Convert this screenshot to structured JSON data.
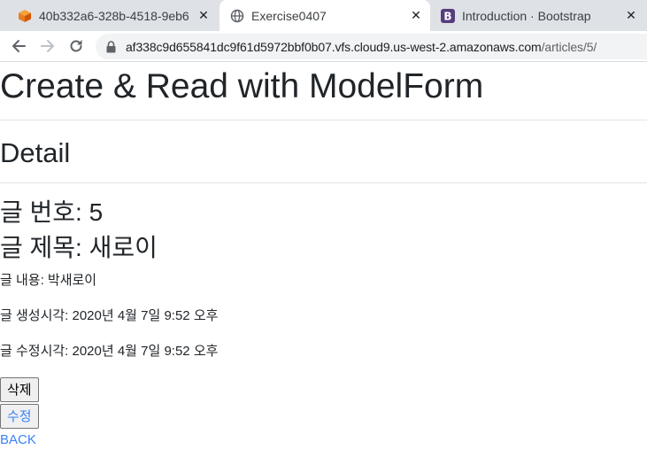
{
  "browser": {
    "tabs": [
      {
        "title": "40b332a6-328b-4518-9eb6",
        "favicon": "cloud9-cube-icon"
      },
      {
        "title": "Exercise0407",
        "favicon": "globe-icon"
      },
      {
        "title": "Introduction · Bootstrap",
        "favicon": "bootstrap-icon"
      }
    ],
    "url_host": "af338c9d655841dc9f61d5972bbf0b07.vfs.cloud9.us-west-2.amazonaws.com",
    "url_path": "/articles/5/"
  },
  "page": {
    "title": "Create & Read with ModelForm",
    "section": "Detail",
    "article_number": "글 번호: 5",
    "article_title": "글 제목: 새로이",
    "content": "글 내용: 박새로이",
    "created_at": "글 생성시각: 2020년 4월 7일 9:52 오후",
    "updated_at": "글 수정시각: 2020년 4월 7일 9:52 오후",
    "delete_label": "삭제",
    "edit_label": "수정",
    "back_label": "BACK"
  },
  "colors": {
    "link": "#3b82f6",
    "tabstrip": "#dee1e6"
  }
}
